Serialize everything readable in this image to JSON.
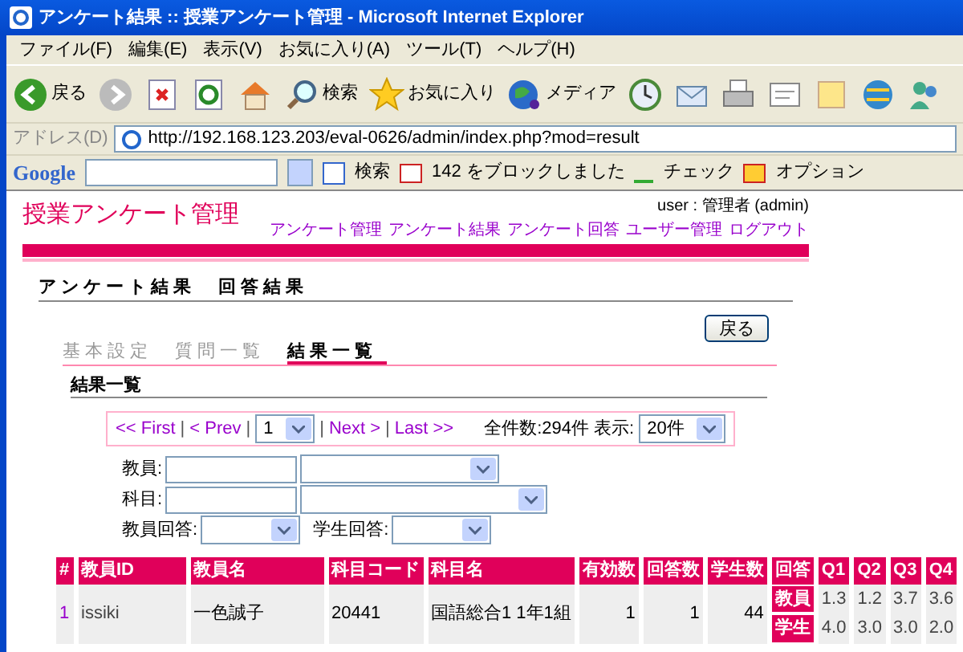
{
  "window": {
    "title": "アンケート結果 :: 授業アンケート管理 - Microsoft Internet Explorer"
  },
  "menu": [
    "ファイル(F)",
    "編集(E)",
    "表示(V)",
    "お気に入り(A)",
    "ツール(T)",
    "ヘルプ(H)"
  ],
  "toolbar": [
    {
      "kind": "back",
      "label": "戻る"
    },
    {
      "kind": "forward"
    },
    {
      "kind": "stop"
    },
    {
      "kind": "refresh"
    },
    {
      "kind": "home"
    },
    {
      "kind": "search",
      "label": "検索"
    },
    {
      "kind": "favorites",
      "label": "お気に入り"
    },
    {
      "kind": "media",
      "label": "メディア"
    },
    {
      "kind": "history"
    },
    {
      "kind": "mail"
    },
    {
      "kind": "print"
    },
    {
      "kind": "edit"
    },
    {
      "kind": "note"
    },
    {
      "kind": "globe"
    },
    {
      "kind": "messenger"
    }
  ],
  "address": {
    "label": "アドレス(D)",
    "url": "http://192.168.123.203/eval-0626/admin/index.php?mod=result"
  },
  "google_bar": {
    "logo": "Google",
    "search_label": "検索",
    "blocked": "142 をブロックしました",
    "check": "チェック",
    "options": "オプション"
  },
  "page": {
    "app_title": "授業アンケート管理",
    "user": "user : 管理者 (admin)",
    "nav": [
      "アンケート管理",
      "アンケート結果",
      "アンケート回答",
      "ユーザー管理",
      "ログアウト"
    ],
    "heading": "アンケート結果　回答結果",
    "back_button": "戻る",
    "tabs": [
      {
        "label": "基本設定",
        "selected": false
      },
      {
        "label": "質問一覧",
        "selected": false
      },
      {
        "label": "結果一覧",
        "selected": true
      }
    ],
    "section_title": "結果一覧",
    "pager": {
      "separator": "|",
      "first": "<< First",
      "prev": "< Prev",
      "page": "1",
      "next": "Next >",
      "last": "Last >>",
      "total": "全件数:294件",
      "show_label": "表示:",
      "show_value": "20件"
    },
    "filters": {
      "teacher_label": "教員:",
      "subject_label": "科目:",
      "teacher_answer_label": "教員回答:",
      "student_answer_label": "学生回答:"
    },
    "table": {
      "columns": [
        "#",
        "教員ID",
        "教員名",
        "科目コード",
        "科目名",
        "有効数",
        "回答数",
        "学生数",
        "回答",
        "Q1",
        "Q2",
        "Q3",
        "Q4"
      ],
      "rows": [
        {
          "num": "1",
          "teacher_id": "issiki",
          "teacher_name": "一色誠子",
          "subject_code": "20441",
          "subject_name": "国語総合1 1年1組",
          "valid": "1",
          "answers": "1",
          "students": "44",
          "answer_rows": [
            {
              "label": "教員",
              "q": [
                "1.3",
                "1.2",
                "3.7",
                "3.6"
              ]
            },
            {
              "label": "学生",
              "q": [
                "4.0",
                "3.0",
                "3.0",
                "2.0"
              ]
            }
          ]
        }
      ]
    }
  }
}
